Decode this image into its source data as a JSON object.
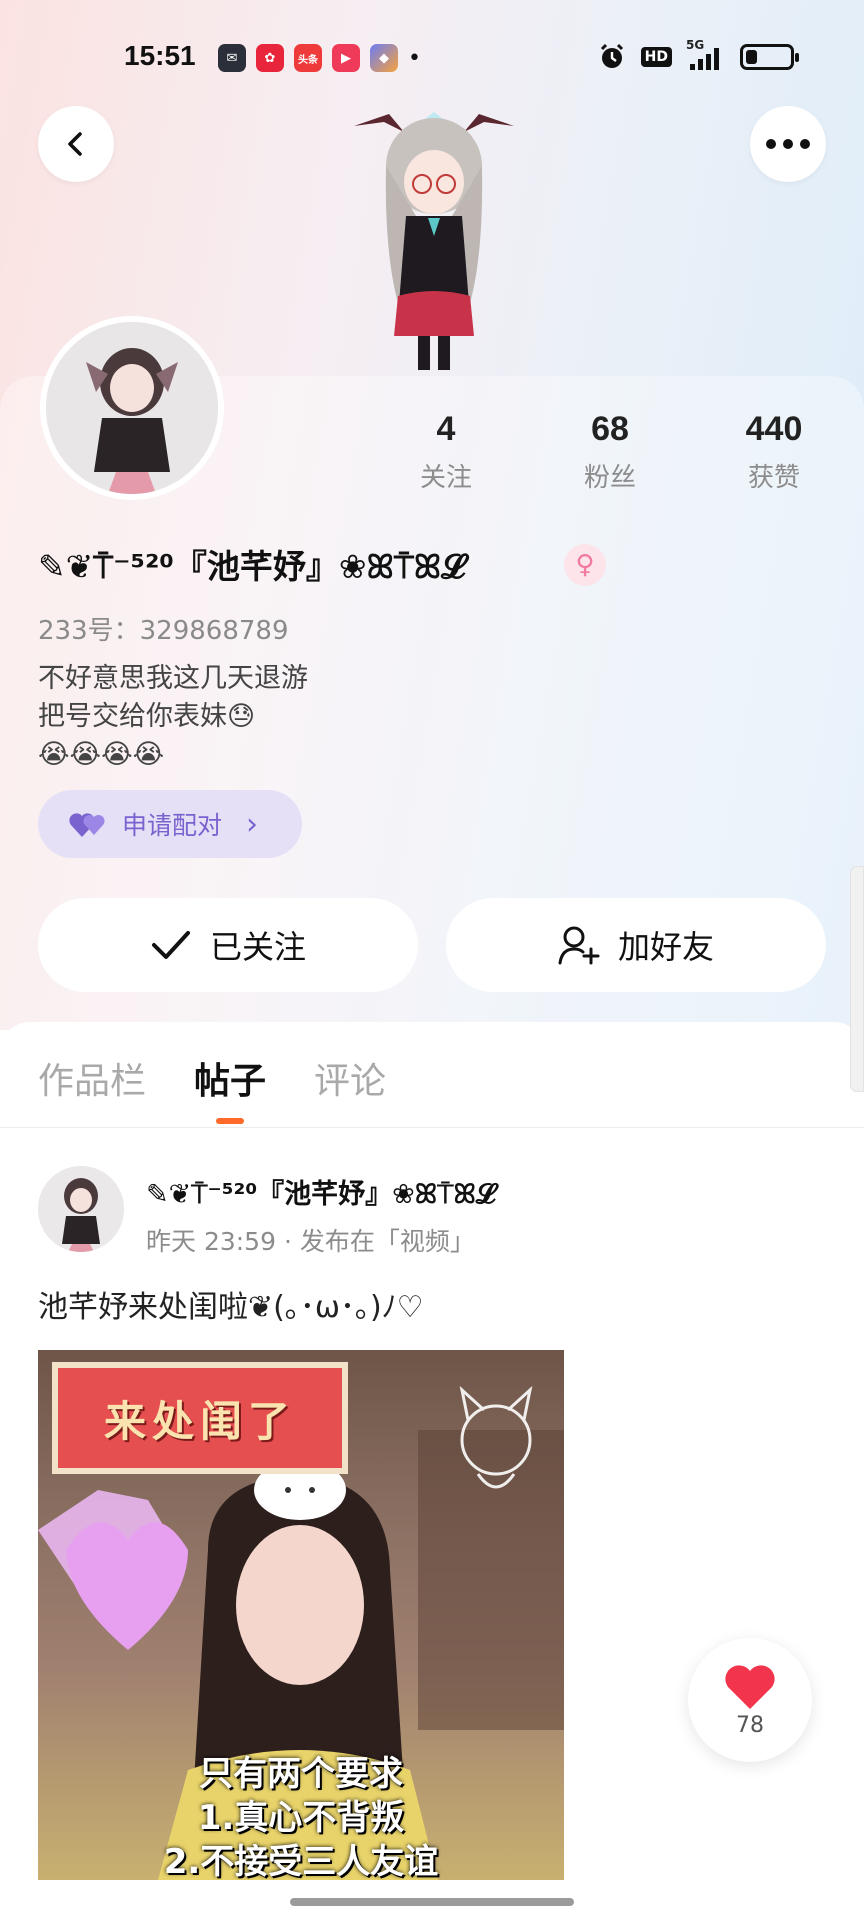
{
  "status_bar": {
    "time": "15:51",
    "app_icons": [
      {
        "name": "mail-app-icon",
        "color": "#2b2f3a",
        "glyph": "✉"
      },
      {
        "name": "red-app-icon",
        "color": "#e8253b",
        "glyph": "✿"
      },
      {
        "name": "toutiao-app-icon",
        "color": "#ee3a3a",
        "glyph": "头条"
      },
      {
        "name": "video-app-icon",
        "color": "#f03a5a",
        "glyph": "▶"
      },
      {
        "name": "shortcut-app-icon",
        "color": "#6b7cf5",
        "glyph": "◆"
      }
    ],
    "dot": "•",
    "hd_label": "HD",
    "network_label": "5G",
    "battery_level": 0.25
  },
  "header": {
    "back_icon": "chevron-left-icon",
    "more_icon": "more-horizontal-icon"
  },
  "stats": [
    {
      "value": "4",
      "label": "关注"
    },
    {
      "value": "68",
      "label": "粉丝"
    },
    {
      "value": "440",
      "label": "获赞"
    }
  ],
  "profile": {
    "username": "✎❦⍑⁻⁵²⁰『池芊妤』❀ꕤ⍑ꕤ𝓛",
    "gender_icon": "♀",
    "account_id": "233号：329868789",
    "bio_lines": [
      "不好意思我这几天退游",
      "把号交给你表妹😓",
      "😭😭😭😭"
    ]
  },
  "pair_button": {
    "label": "申请配对",
    "arrow": "›"
  },
  "actions": {
    "follow_label": "已关注",
    "add_friend_label": "加好友"
  },
  "tabs": [
    {
      "label": "作品栏",
      "active": false
    },
    {
      "label": "帖子",
      "active": true
    },
    {
      "label": "评论",
      "active": false
    }
  ],
  "post": {
    "author": "✎❦⍑⁻⁵²⁰『池芊妤』❀ꕤ⍑ꕤ𝓛",
    "meta": "昨天 23:59 · 发布在「视频」",
    "text": "池芊妤来处闺啦❦(｡･ω･｡)ﾉ♡",
    "image": {
      "banner_text": "来处闺了",
      "caption_lines": [
        "只有两个要求",
        "1.真心不背叛",
        "2.不接受三人友谊"
      ]
    }
  },
  "like": {
    "count": "78"
  },
  "colors": {
    "accent_orange": "#ff6a2b",
    "pair_purple": "#7a62cf",
    "like_red": "#f2344c"
  }
}
